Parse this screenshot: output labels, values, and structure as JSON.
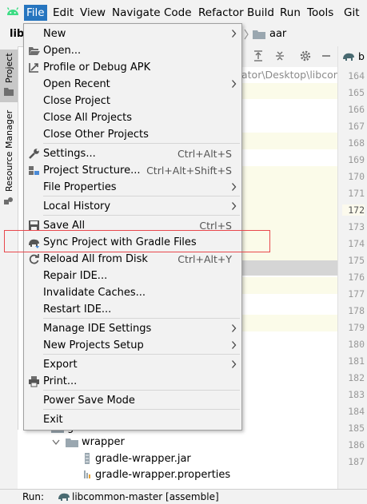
{
  "menubar": {
    "items": [
      "File",
      "Edit",
      "View",
      "Navigate",
      "Code",
      "Refactor",
      "Build",
      "Run",
      "Tools",
      "Git"
    ]
  },
  "navbar": {
    "project_prefix": "lib",
    "crumb_last": "aar",
    "path_fragment": "ator\\Desktop\\libcom"
  },
  "left_strip": {
    "project_tab": "Project",
    "resource_tab": "Resource Manager"
  },
  "file_menu": {
    "items": [
      {
        "label": "New",
        "shortcut": "",
        "submenu": true
      },
      {
        "label": "Open...",
        "shortcut": "",
        "submenu": false
      },
      {
        "label": "Profile or Debug APK",
        "shortcut": "",
        "submenu": false
      },
      {
        "label": "Open Recent",
        "shortcut": "",
        "submenu": true
      },
      {
        "label": "Close Project",
        "shortcut": "",
        "submenu": false
      },
      {
        "label": "Close All Projects",
        "shortcut": "",
        "submenu": false
      },
      {
        "label": "Close Other Projects",
        "shortcut": "",
        "submenu": false
      },
      {
        "label": "Settings...",
        "shortcut": "Ctrl+Alt+S",
        "submenu": false
      },
      {
        "label": "Project Structure...",
        "shortcut": "Ctrl+Alt+Shift+S",
        "submenu": false
      },
      {
        "label": "File Properties",
        "shortcut": "",
        "submenu": true
      },
      {
        "label": "Local History",
        "shortcut": "",
        "submenu": true
      },
      {
        "label": "Save All",
        "shortcut": "Ctrl+S",
        "submenu": false
      },
      {
        "label": "Sync Project with Gradle Files",
        "shortcut": "",
        "submenu": false
      },
      {
        "label": "Reload All from Disk",
        "shortcut": "Ctrl+Alt+Y",
        "submenu": false
      },
      {
        "label": "Repair IDE...",
        "shortcut": "",
        "submenu": false
      },
      {
        "label": "Invalidate Caches...",
        "shortcut": "",
        "submenu": false
      },
      {
        "label": "Restart IDE...",
        "shortcut": "",
        "submenu": false
      },
      {
        "label": "Manage IDE Settings",
        "shortcut": "",
        "submenu": true
      },
      {
        "label": "New Projects Setup",
        "shortcut": "",
        "submenu": true
      },
      {
        "label": "Export",
        "shortcut": "",
        "submenu": true
      },
      {
        "label": "Print...",
        "shortcut": "",
        "submenu": false
      },
      {
        "label": "Power Save Mode",
        "shortcut": "",
        "submenu": false
      },
      {
        "label": "Exit",
        "shortcut": "",
        "submenu": false
      }
    ]
  },
  "tree": {
    "gradle": "gradle",
    "wrapper": "wrapper",
    "jar": "gradle-wrapper.jar",
    "props": "gradle-wrapper.properties"
  },
  "gutter": {
    "tab": "b",
    "lines": [
      "164",
      "165",
      "166",
      "167",
      "168",
      "169",
      "170",
      "171",
      "172",
      "173",
      "174",
      "175",
      "176",
      "177",
      "178",
      "179",
      "180",
      "181",
      "182",
      "183",
      "184",
      "185",
      "186",
      "187"
    ],
    "active_line": "172"
  },
  "status": {
    "run_label": "Run:",
    "task": "libcommon-master [assemble]"
  },
  "colors": {
    "menu_selected": "#2675bf",
    "highlight_box": "#e8474c",
    "android_green": "#3ddc84"
  }
}
